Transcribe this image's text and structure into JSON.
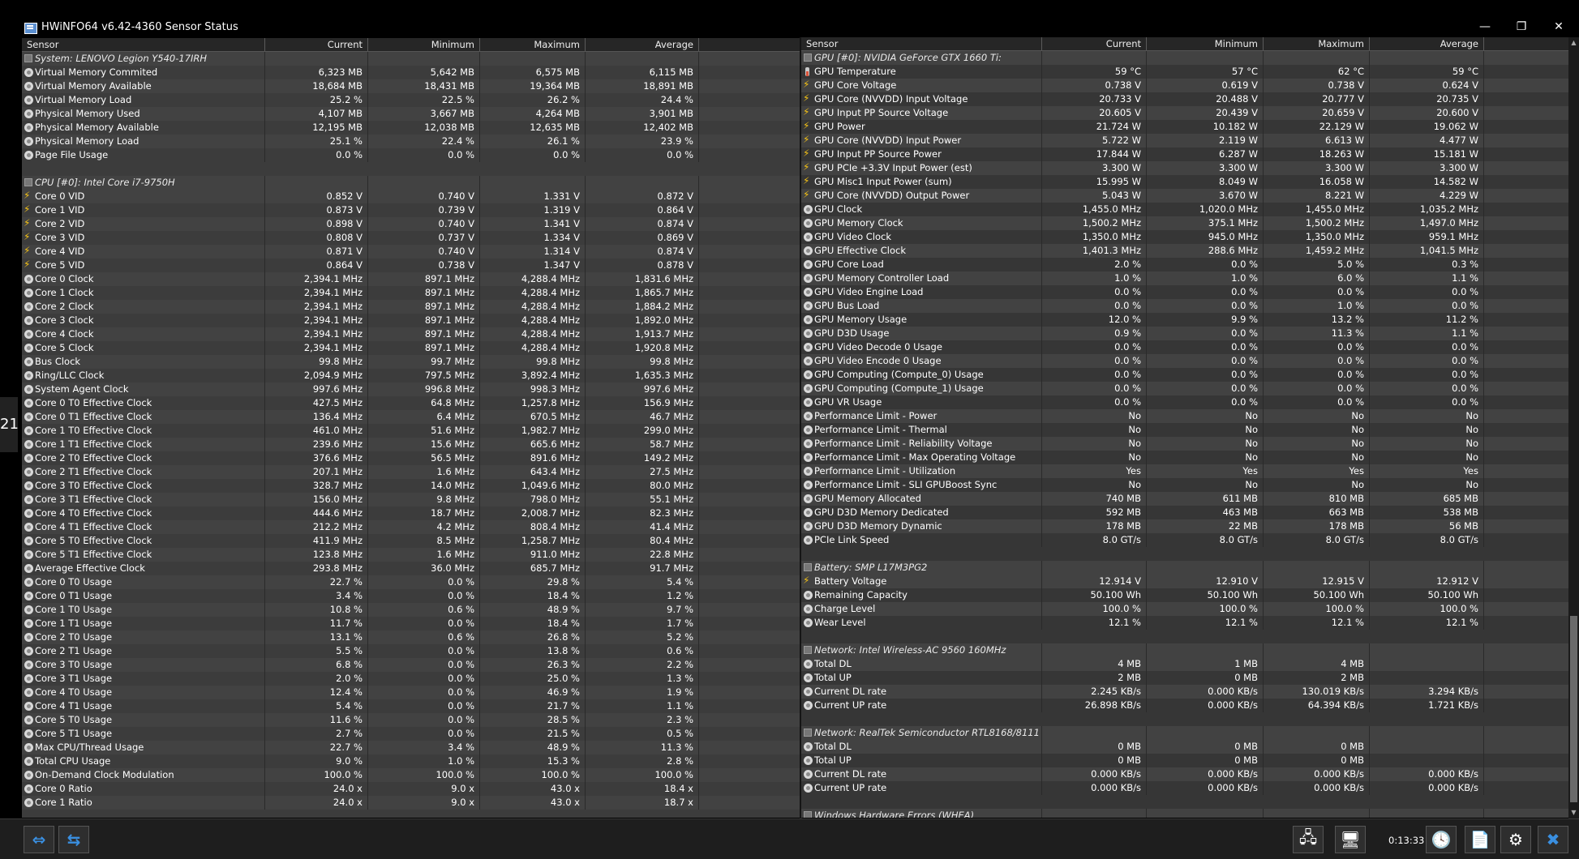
{
  "window": {
    "title": "HWiNFO64 v6.42-4360 Sensor Status",
    "minimize": "—",
    "restore": "❐",
    "close": "✕",
    "edge_label": "21"
  },
  "columns": {
    "sensor": "Sensor",
    "current": "Current",
    "minimum": "Minimum",
    "maximum": "Maximum",
    "average": "Average"
  },
  "left": [
    {
      "g": "System: LENOVO Legion Y540-17IRH"
    },
    {
      "i": "clock",
      "n": "Virtual Memory Commited",
      "c": "6,323 MB",
      "mi": "5,642 MB",
      "ma": "6,575 MB",
      "a": "6,115 MB"
    },
    {
      "i": "clock",
      "n": "Virtual Memory Available",
      "c": "18,684 MB",
      "mi": "18,431 MB",
      "ma": "19,364 MB",
      "a": "18,891 MB"
    },
    {
      "i": "clock",
      "n": "Virtual Memory Load",
      "c": "25.2 %",
      "mi": "22.5 %",
      "ma": "26.2 %",
      "a": "24.4 %"
    },
    {
      "i": "clock",
      "n": "Physical Memory Used",
      "c": "4,107 MB",
      "mi": "3,667 MB",
      "ma": "4,264 MB",
      "a": "3,901 MB"
    },
    {
      "i": "clock",
      "n": "Physical Memory Available",
      "c": "12,195 MB",
      "mi": "12,038 MB",
      "ma": "12,635 MB",
      "a": "12,402 MB"
    },
    {
      "i": "clock",
      "n": "Physical Memory Load",
      "c": "25.1 %",
      "mi": "22.4 %",
      "ma": "26.1 %",
      "a": "23.9 %"
    },
    {
      "i": "clock",
      "n": "Page File Usage",
      "c": "0.0 %",
      "mi": "0.0 %",
      "ma": "0.0 %",
      "a": "0.0 %"
    },
    {
      "s": 1
    },
    {
      "g": "CPU [#0]: Intel Core i7-9750H"
    },
    {
      "i": "volt",
      "n": "Core 0 VID",
      "c": "0.852 V",
      "mi": "0.740 V",
      "ma": "1.331 V",
      "a": "0.872 V"
    },
    {
      "i": "volt",
      "n": "Core 1 VID",
      "c": "0.873 V",
      "mi": "0.739 V",
      "ma": "1.319 V",
      "a": "0.864 V"
    },
    {
      "i": "volt",
      "n": "Core 2 VID",
      "c": "0.898 V",
      "mi": "0.740 V",
      "ma": "1.341 V",
      "a": "0.874 V"
    },
    {
      "i": "volt",
      "n": "Core 3 VID",
      "c": "0.808 V",
      "mi": "0.737 V",
      "ma": "1.334 V",
      "a": "0.869 V"
    },
    {
      "i": "volt",
      "n": "Core 4 VID",
      "c": "0.871 V",
      "mi": "0.740 V",
      "ma": "1.314 V",
      "a": "0.874 V"
    },
    {
      "i": "volt",
      "n": "Core 5 VID",
      "c": "0.864 V",
      "mi": "0.738 V",
      "ma": "1.347 V",
      "a": "0.878 V"
    },
    {
      "i": "clock",
      "n": "Core 0 Clock",
      "c": "2,394.1 MHz",
      "mi": "897.1 MHz",
      "ma": "4,288.4 MHz",
      "a": "1,831.6 MHz"
    },
    {
      "i": "clock",
      "n": "Core 1 Clock",
      "c": "2,394.1 MHz",
      "mi": "897.1 MHz",
      "ma": "4,288.4 MHz",
      "a": "1,865.7 MHz"
    },
    {
      "i": "clock",
      "n": "Core 2 Clock",
      "c": "2,394.1 MHz",
      "mi": "897.1 MHz",
      "ma": "4,288.4 MHz",
      "a": "1,884.2 MHz"
    },
    {
      "i": "clock",
      "n": "Core 3 Clock",
      "c": "2,394.1 MHz",
      "mi": "897.1 MHz",
      "ma": "4,288.4 MHz",
      "a": "1,892.0 MHz"
    },
    {
      "i": "clock",
      "n": "Core 4 Clock",
      "c": "2,394.1 MHz",
      "mi": "897.1 MHz",
      "ma": "4,288.4 MHz",
      "a": "1,913.7 MHz"
    },
    {
      "i": "clock",
      "n": "Core 5 Clock",
      "c": "2,394.1 MHz",
      "mi": "897.1 MHz",
      "ma": "4,288.4 MHz",
      "a": "1,920.8 MHz"
    },
    {
      "i": "clock",
      "n": "Bus Clock",
      "c": "99.8 MHz",
      "mi": "99.7 MHz",
      "ma": "99.8 MHz",
      "a": "99.8 MHz"
    },
    {
      "i": "clock",
      "n": "Ring/LLC Clock",
      "c": "2,094.9 MHz",
      "mi": "797.5 MHz",
      "ma": "3,892.4 MHz",
      "a": "1,635.3 MHz"
    },
    {
      "i": "clock",
      "n": "System Agent Clock",
      "c": "997.6 MHz",
      "mi": "996.8 MHz",
      "ma": "998.3 MHz",
      "a": "997.6 MHz"
    },
    {
      "i": "clock",
      "n": "Core 0 T0 Effective Clock",
      "c": "427.5 MHz",
      "mi": "64.8 MHz",
      "ma": "1,257.8 MHz",
      "a": "156.9 MHz"
    },
    {
      "i": "clock",
      "n": "Core 0 T1 Effective Clock",
      "c": "136.4 MHz",
      "mi": "6.4 MHz",
      "ma": "670.5 MHz",
      "a": "46.7 MHz"
    },
    {
      "i": "clock",
      "n": "Core 1 T0 Effective Clock",
      "c": "461.0 MHz",
      "mi": "51.6 MHz",
      "ma": "1,982.7 MHz",
      "a": "299.0 MHz"
    },
    {
      "i": "clock",
      "n": "Core 1 T1 Effective Clock",
      "c": "239.6 MHz",
      "mi": "15.6 MHz",
      "ma": "665.6 MHz",
      "a": "58.7 MHz"
    },
    {
      "i": "clock",
      "n": "Core 2 T0 Effective Clock",
      "c": "376.6 MHz",
      "mi": "56.5 MHz",
      "ma": "891.6 MHz",
      "a": "149.2 MHz"
    },
    {
      "i": "clock",
      "n": "Core 2 T1 Effective Clock",
      "c": "207.1 MHz",
      "mi": "1.6 MHz",
      "ma": "643.4 MHz",
      "a": "27.5 MHz"
    },
    {
      "i": "clock",
      "n": "Core 3 T0 Effective Clock",
      "c": "328.7 MHz",
      "mi": "14.0 MHz",
      "ma": "1,049.6 MHz",
      "a": "80.0 MHz"
    },
    {
      "i": "clock",
      "n": "Core 3 T1 Effective Clock",
      "c": "156.0 MHz",
      "mi": "9.8 MHz",
      "ma": "798.0 MHz",
      "a": "55.1 MHz"
    },
    {
      "i": "clock",
      "n": "Core 4 T0 Effective Clock",
      "c": "444.6 MHz",
      "mi": "18.7 MHz",
      "ma": "2,008.7 MHz",
      "a": "82.3 MHz"
    },
    {
      "i": "clock",
      "n": "Core 4 T1 Effective Clock",
      "c": "212.2 MHz",
      "mi": "4.2 MHz",
      "ma": "808.4 MHz",
      "a": "41.4 MHz"
    },
    {
      "i": "clock",
      "n": "Core 5 T0 Effective Clock",
      "c": "411.9 MHz",
      "mi": "8.5 MHz",
      "ma": "1,258.7 MHz",
      "a": "80.4 MHz"
    },
    {
      "i": "clock",
      "n": "Core 5 T1 Effective Clock",
      "c": "123.8 MHz",
      "mi": "1.6 MHz",
      "ma": "911.0 MHz",
      "a": "22.8 MHz"
    },
    {
      "i": "clock",
      "n": "Average Effective Clock",
      "c": "293.8 MHz",
      "mi": "36.0 MHz",
      "ma": "685.7 MHz",
      "a": "91.7 MHz"
    },
    {
      "i": "clock",
      "n": "Core 0 T0 Usage",
      "c": "22.7 %",
      "mi": "0.0 %",
      "ma": "29.8 %",
      "a": "5.4 %"
    },
    {
      "i": "clock",
      "n": "Core 0 T1 Usage",
      "c": "3.4 %",
      "mi": "0.0 %",
      "ma": "18.4 %",
      "a": "1.2 %"
    },
    {
      "i": "clock",
      "n": "Core 1 T0 Usage",
      "c": "10.8 %",
      "mi": "0.6 %",
      "ma": "48.9 %",
      "a": "9.7 %"
    },
    {
      "i": "clock",
      "n": "Core 1 T1 Usage",
      "c": "11.7 %",
      "mi": "0.0 %",
      "ma": "18.4 %",
      "a": "1.7 %"
    },
    {
      "i": "clock",
      "n": "Core 2 T0 Usage",
      "c": "13.1 %",
      "mi": "0.6 %",
      "ma": "26.8 %",
      "a": "5.2 %"
    },
    {
      "i": "clock",
      "n": "Core 2 T1 Usage",
      "c": "5.5 %",
      "mi": "0.0 %",
      "ma": "13.8 %",
      "a": "0.6 %"
    },
    {
      "i": "clock",
      "n": "Core 3 T0 Usage",
      "c": "6.8 %",
      "mi": "0.0 %",
      "ma": "26.3 %",
      "a": "2.2 %"
    },
    {
      "i": "clock",
      "n": "Core 3 T1 Usage",
      "c": "2.0 %",
      "mi": "0.0 %",
      "ma": "25.0 %",
      "a": "1.3 %"
    },
    {
      "i": "clock",
      "n": "Core 4 T0 Usage",
      "c": "12.4 %",
      "mi": "0.0 %",
      "ma": "46.9 %",
      "a": "1.9 %"
    },
    {
      "i": "clock",
      "n": "Core 4 T1 Usage",
      "c": "5.4 %",
      "mi": "0.0 %",
      "ma": "21.7 %",
      "a": "1.1 %"
    },
    {
      "i": "clock",
      "n": "Core 5 T0 Usage",
      "c": "11.6 %",
      "mi": "0.0 %",
      "ma": "28.5 %",
      "a": "2.3 %"
    },
    {
      "i": "clock",
      "n": "Core 5 T1 Usage",
      "c": "2.7 %",
      "mi": "0.0 %",
      "ma": "21.5 %",
      "a": "0.5 %"
    },
    {
      "i": "clock",
      "n": "Max CPU/Thread Usage",
      "c": "22.7 %",
      "mi": "3.4 %",
      "ma": "48.9 %",
      "a": "11.3 %"
    },
    {
      "i": "clock",
      "n": "Total CPU Usage",
      "c": "9.0 %",
      "mi": "1.0 %",
      "ma": "15.3 %",
      "a": "2.8 %"
    },
    {
      "i": "clock",
      "n": "On-Demand Clock Modulation",
      "c": "100.0 %",
      "mi": "100.0 %",
      "ma": "100.0 %",
      "a": "100.0 %"
    },
    {
      "i": "clock",
      "n": "Core 0 Ratio",
      "c": "24.0 x",
      "mi": "9.0 x",
      "ma": "43.0 x",
      "a": "18.4 x"
    },
    {
      "i": "clock",
      "n": "Core 1 Ratio",
      "c": "24.0 x",
      "mi": "9.0 x",
      "ma": "43.0 x",
      "a": "18.7 x"
    }
  ],
  "right": [
    {
      "g": "GPU [#0]: NVIDIA GeForce GTX 1660 Ti:"
    },
    {
      "i": "temp",
      "n": "GPU Temperature",
      "c": "59 °C",
      "mi": "57 °C",
      "ma": "62 °C",
      "a": "59 °C"
    },
    {
      "i": "volt",
      "n": "GPU Core Voltage",
      "c": "0.738 V",
      "mi": "0.619 V",
      "ma": "0.738 V",
      "a": "0.624 V"
    },
    {
      "i": "volt",
      "n": "GPU Core (NVVDD) Input Voltage",
      "c": "20.733 V",
      "mi": "20.488 V",
      "ma": "20.777 V",
      "a": "20.735 V"
    },
    {
      "i": "volt",
      "n": "GPU Input PP Source Voltage",
      "c": "20.605 V",
      "mi": "20.439 V",
      "ma": "20.659 V",
      "a": "20.600 V"
    },
    {
      "i": "volt",
      "n": "GPU Power",
      "c": "21.724 W",
      "mi": "10.182 W",
      "ma": "22.129 W",
      "a": "19.062 W"
    },
    {
      "i": "volt",
      "n": "GPU Core (NVVDD) Input Power",
      "c": "5.722 W",
      "mi": "2.119 W",
      "ma": "6.613 W",
      "a": "4.477 W"
    },
    {
      "i": "volt",
      "n": "GPU Input PP Source Power",
      "c": "17.844 W",
      "mi": "6.287 W",
      "ma": "18.263 W",
      "a": "15.181 W"
    },
    {
      "i": "volt",
      "n": "GPU PCIe +3.3V Input Power (est)",
      "c": "3.300 W",
      "mi": "3.300 W",
      "ma": "3.300 W",
      "a": "3.300 W"
    },
    {
      "i": "volt",
      "n": "GPU Misc1 Input Power (sum)",
      "c": "15.995 W",
      "mi": "8.049 W",
      "ma": "16.058 W",
      "a": "14.582 W"
    },
    {
      "i": "volt",
      "n": "GPU Core (NVVDD) Output Power",
      "c": "5.043 W",
      "mi": "3.670 W",
      "ma": "8.221 W",
      "a": "4.229 W"
    },
    {
      "i": "clock",
      "n": "GPU Clock",
      "c": "1,455.0 MHz",
      "mi": "1,020.0 MHz",
      "ma": "1,455.0 MHz",
      "a": "1,035.2 MHz"
    },
    {
      "i": "clock",
      "n": "GPU Memory Clock",
      "c": "1,500.2 MHz",
      "mi": "375.1 MHz",
      "ma": "1,500.2 MHz",
      "a": "1,497.0 MHz"
    },
    {
      "i": "clock",
      "n": "GPU Video Clock",
      "c": "1,350.0 MHz",
      "mi": "945.0 MHz",
      "ma": "1,350.0 MHz",
      "a": "959.1 MHz"
    },
    {
      "i": "clock",
      "n": "GPU Effective Clock",
      "c": "1,401.3 MHz",
      "mi": "288.6 MHz",
      "ma": "1,459.2 MHz",
      "a": "1,041.5 MHz"
    },
    {
      "i": "clock",
      "n": "GPU Core Load",
      "c": "2.0 %",
      "mi": "0.0 %",
      "ma": "5.0 %",
      "a": "0.3 %"
    },
    {
      "i": "clock",
      "n": "GPU Memory Controller Load",
      "c": "1.0 %",
      "mi": "1.0 %",
      "ma": "6.0 %",
      "a": "1.1 %"
    },
    {
      "i": "clock",
      "n": "GPU Video Engine Load",
      "c": "0.0 %",
      "mi": "0.0 %",
      "ma": "0.0 %",
      "a": "0.0 %"
    },
    {
      "i": "clock",
      "n": "GPU Bus Load",
      "c": "0.0 %",
      "mi": "0.0 %",
      "ma": "1.0 %",
      "a": "0.0 %"
    },
    {
      "i": "clock",
      "n": "GPU Memory Usage",
      "c": "12.0 %",
      "mi": "9.9 %",
      "ma": "13.2 %",
      "a": "11.2 %"
    },
    {
      "i": "clock",
      "n": "GPU D3D Usage",
      "c": "0.9 %",
      "mi": "0.0 %",
      "ma": "11.3 %",
      "a": "1.1 %"
    },
    {
      "i": "clock",
      "n": "GPU Video Decode 0 Usage",
      "c": "0.0 %",
      "mi": "0.0 %",
      "ma": "0.0 %",
      "a": "0.0 %"
    },
    {
      "i": "clock",
      "n": "GPU Video Encode 0 Usage",
      "c": "0.0 %",
      "mi": "0.0 %",
      "ma": "0.0 %",
      "a": "0.0 %"
    },
    {
      "i": "clock",
      "n": "GPU Computing (Compute_0) Usage",
      "c": "0.0 %",
      "mi": "0.0 %",
      "ma": "0.0 %",
      "a": "0.0 %"
    },
    {
      "i": "clock",
      "n": "GPU Computing (Compute_1) Usage",
      "c": "0.0 %",
      "mi": "0.0 %",
      "ma": "0.0 %",
      "a": "0.0 %"
    },
    {
      "i": "clock",
      "n": "GPU VR Usage",
      "c": "0.0 %",
      "mi": "0.0 %",
      "ma": "0.0 %",
      "a": "0.0 %"
    },
    {
      "i": "clock",
      "n": "Performance Limit - Power",
      "c": "No",
      "mi": "No",
      "ma": "No",
      "a": "No"
    },
    {
      "i": "clock",
      "n": "Performance Limit - Thermal",
      "c": "No",
      "mi": "No",
      "ma": "No",
      "a": "No"
    },
    {
      "i": "clock",
      "n": "Performance Limit - Reliability Voltage",
      "c": "No",
      "mi": "No",
      "ma": "No",
      "a": "No"
    },
    {
      "i": "clock",
      "n": "Performance Limit - Max Operating Voltage",
      "c": "No",
      "mi": "No",
      "ma": "No",
      "a": "No"
    },
    {
      "i": "clock",
      "n": "Performance Limit - Utilization",
      "c": "Yes",
      "mi": "Yes",
      "ma": "Yes",
      "a": "Yes"
    },
    {
      "i": "clock",
      "n": "Performance Limit - SLI GPUBoost Sync",
      "c": "No",
      "mi": "No",
      "ma": "No",
      "a": "No"
    },
    {
      "i": "clock",
      "n": "GPU Memory Allocated",
      "c": "740 MB",
      "mi": "611 MB",
      "ma": "810 MB",
      "a": "685 MB"
    },
    {
      "i": "clock",
      "n": "GPU D3D Memory Dedicated",
      "c": "592 MB",
      "mi": "463 MB",
      "ma": "663 MB",
      "a": "538 MB"
    },
    {
      "i": "clock",
      "n": "GPU D3D Memory Dynamic",
      "c": "178 MB",
      "mi": "22 MB",
      "ma": "178 MB",
      "a": "56 MB"
    },
    {
      "i": "clock",
      "n": "PCIe Link Speed",
      "c": "8.0 GT/s",
      "mi": "8.0 GT/s",
      "ma": "8.0 GT/s",
      "a": "8.0 GT/s"
    },
    {
      "s": 1
    },
    {
      "g": "Battery: SMP L17M3PG2"
    },
    {
      "i": "volt",
      "n": "Battery Voltage",
      "c": "12.914 V",
      "mi": "12.910 V",
      "ma": "12.915 V",
      "a": "12.912 V"
    },
    {
      "i": "clock",
      "n": "Remaining Capacity",
      "c": "50.100 Wh",
      "mi": "50.100 Wh",
      "ma": "50.100 Wh",
      "a": "50.100 Wh"
    },
    {
      "i": "clock",
      "n": "Charge Level",
      "c": "100.0 %",
      "mi": "100.0 %",
      "ma": "100.0 %",
      "a": "100.0 %"
    },
    {
      "i": "clock",
      "n": "Wear Level",
      "c": "12.1 %",
      "mi": "12.1 %",
      "ma": "12.1 %",
      "a": "12.1 %"
    },
    {
      "s": 1
    },
    {
      "g": "Network: Intel Wireless-AC 9560 160MHz"
    },
    {
      "i": "clock",
      "n": "Total DL",
      "c": "4 MB",
      "mi": "1 MB",
      "ma": "4 MB",
      "a": ""
    },
    {
      "i": "clock",
      "n": "Total UP",
      "c": "2 MB",
      "mi": "0 MB",
      "ma": "2 MB",
      "a": ""
    },
    {
      "i": "clock",
      "n": "Current DL rate",
      "c": "2.245 KB/s",
      "mi": "0.000 KB/s",
      "ma": "130.019 KB/s",
      "a": "3.294 KB/s"
    },
    {
      "i": "clock",
      "n": "Current UP rate",
      "c": "26.898 KB/s",
      "mi": "0.000 KB/s",
      "ma": "64.394 KB/s",
      "a": "1.721 KB/s"
    },
    {
      "s": 1
    },
    {
      "g": "Network: RealTek Semiconductor RTL8168/8111 PCI-E..."
    },
    {
      "i": "clock",
      "n": "Total DL",
      "c": "0 MB",
      "mi": "0 MB",
      "ma": "0 MB",
      "a": ""
    },
    {
      "i": "clock",
      "n": "Total UP",
      "c": "0 MB",
      "mi": "0 MB",
      "ma": "0 MB",
      "a": ""
    },
    {
      "i": "clock",
      "n": "Current DL rate",
      "c": "0.000 KB/s",
      "mi": "0.000 KB/s",
      "ma": "0.000 KB/s",
      "a": "0.000 KB/s"
    },
    {
      "i": "clock",
      "n": "Current UP rate",
      "c": "0.000 KB/s",
      "mi": "0.000 KB/s",
      "ma": "0.000 KB/s",
      "a": "0.000 KB/s"
    },
    {
      "s": 1
    },
    {
      "g": "Windows Hardware Errors (WHEA)"
    }
  ],
  "toolbar": {
    "timer": "0:13:33"
  }
}
